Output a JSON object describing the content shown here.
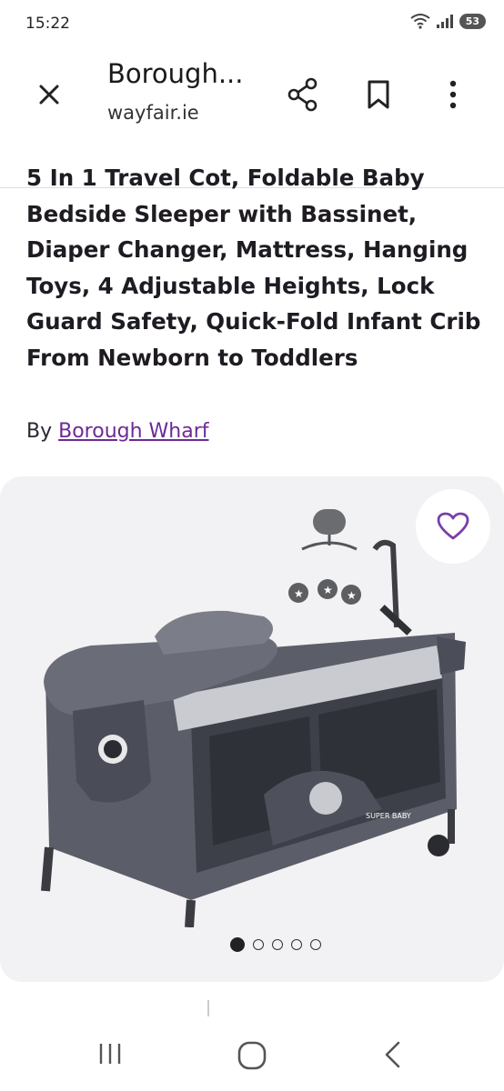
{
  "status_bar": {
    "time": "15:22",
    "battery": "53",
    "icons": [
      "wifi-icon",
      "signal-icon",
      "battery-icon"
    ]
  },
  "header": {
    "title": "Borough...",
    "url": "wayfair.ie",
    "icons": [
      "close-icon",
      "share-icon",
      "bookmark-icon",
      "more-vertical-icon"
    ]
  },
  "product": {
    "title": "5 In 1 Travel Cot, Foldable Baby Bedside Sleeper with Bassinet, Diaper Changer, Mattress, Hanging Toys, 4 Adjustable Heights, Lock Guard Safety, Quick-Fold Infant Crib From Newborn to Toddlers",
    "by_label": "By",
    "brand": "Borough Wharf",
    "image_text": "SUPER BABY",
    "image_count": 5,
    "active_image_index": 0
  },
  "colors": {
    "brand_link": "#6d2a94",
    "favorite_heart": "#7b3fa8",
    "card_background": "#f2f1f3"
  },
  "nav_bar": {
    "icons": [
      "recents-icon",
      "home-icon",
      "back-icon"
    ]
  }
}
